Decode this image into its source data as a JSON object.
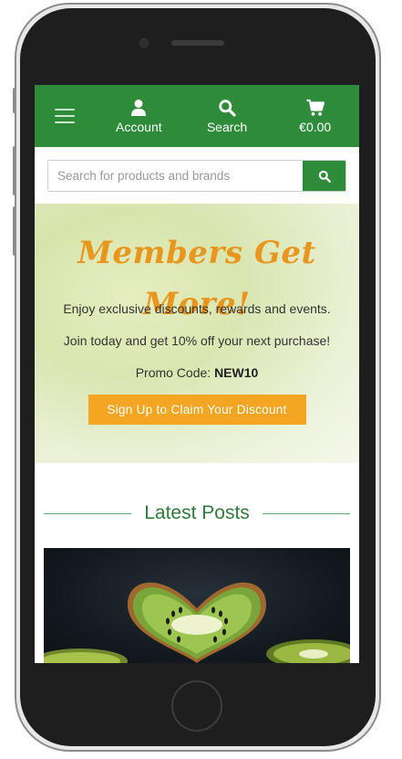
{
  "header": {
    "account_label": "Account",
    "search_label": "Search",
    "cart_label": "€0.00"
  },
  "search": {
    "placeholder": "Search for products and brands"
  },
  "promo": {
    "title": "Members Get More!",
    "line1": "Enjoy exclusive discounts, rewards and events.",
    "line2": "Join today and get 10% off your next purchase!",
    "code_label": "Promo Code:",
    "code_value": "NEW10",
    "button_label": "Sign Up to Claim Your Discount"
  },
  "posts": {
    "heading": "Latest Posts"
  },
  "icons": {
    "menu": "hamburger-icon",
    "account": "user-icon",
    "search": "search-icon",
    "cart": "cart-icon",
    "post": "kiwi-photo"
  },
  "colors": {
    "brand_green": "#2e8b3a",
    "accent_orange": "#f4a521",
    "title_orange": "#e8961e"
  }
}
